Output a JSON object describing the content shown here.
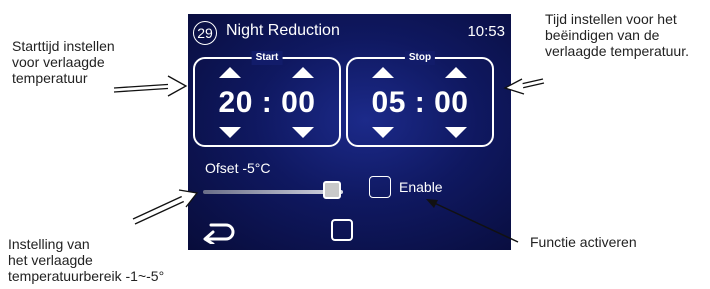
{
  "screen": {
    "number": "29",
    "title": "Night Reduction",
    "clock": "10:53",
    "start": {
      "label": "Start",
      "time": "20 : 00"
    },
    "stop": {
      "label": "Stop",
      "time": "05 : 00"
    },
    "offset_label": "Ofset -5°C",
    "offset_slider_fraction": 0.92,
    "enable_label": "Enable",
    "enable_checked": false
  },
  "annotations": {
    "start_note": [
      "Starttijd instellen",
      "voor verlaagde",
      "temperatuur"
    ],
    "stop_note": [
      "Tijd instellen voor het",
      "beëindigen van de",
      "verlaagde temperatuur."
    ],
    "range_note": [
      "Instelling van",
      "het verlaagde",
      "temperatuurbereik -1~-5°"
    ],
    "enable_note": [
      "Functie activeren"
    ]
  },
  "icons": {
    "up": "triangle-up",
    "down": "triangle-down",
    "back": "back-arrow",
    "home": "square"
  },
  "colors": {
    "screen_bg": "#0f1860",
    "text": "#ffffff"
  }
}
